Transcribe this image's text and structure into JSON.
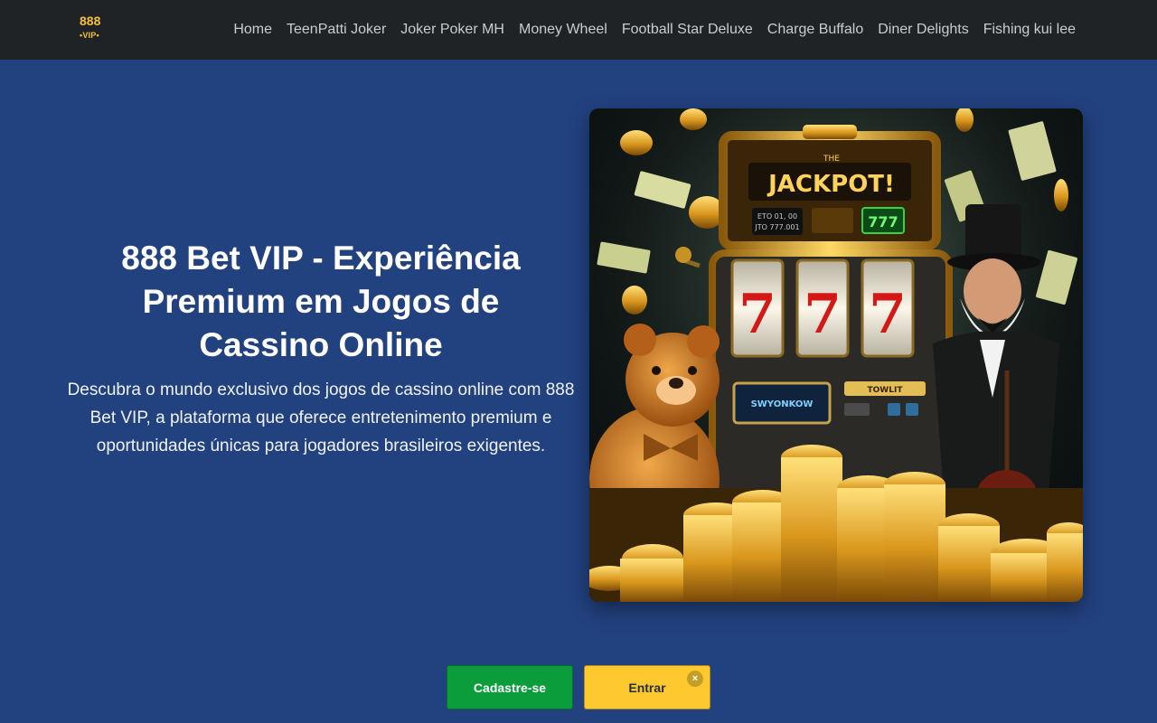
{
  "header": {
    "logo_top": "888",
    "logo_bottom": "•VIP•",
    "nav": [
      {
        "label": "Home"
      },
      {
        "label": "TeenPatti Joker"
      },
      {
        "label": "Joker Poker MH"
      },
      {
        "label": "Money Wheel"
      },
      {
        "label": "Football Star Deluxe"
      },
      {
        "label": "Charge Buffalo"
      },
      {
        "label": "Diner Delights"
      },
      {
        "label": "Fishing kui lee"
      }
    ]
  },
  "hero": {
    "title": "888 Bet VIP - Experiência Premium em Jogos de Cassino Online",
    "description": "Descubra o mundo exclusivo dos jogos de cassino online com 888 Bet VIP, a plataforma que oferece entretenimento premium e oportunidades únicas para jogadores brasileiros exigentes.",
    "image": {
      "jackpot_text": "JACKPOT!",
      "jackpot_prefix": "THE",
      "counter": "777",
      "reel_symbol": "7",
      "left_display": "ETO 01, 00",
      "left_display_2": "JTO 777.001",
      "panel_text": "SWYONKOW",
      "tower_text": "TOWLIT"
    }
  },
  "cta": {
    "register_label": "Cadastre-se",
    "login_label": "Entrar",
    "close_symbol": "×"
  },
  "colors": {
    "page_bg": "#22417f",
    "topbar_bg": "#202326",
    "logo_gold": "#f4c03a",
    "register_green": "#0b9d3c",
    "login_yellow": "#fdc92f"
  }
}
